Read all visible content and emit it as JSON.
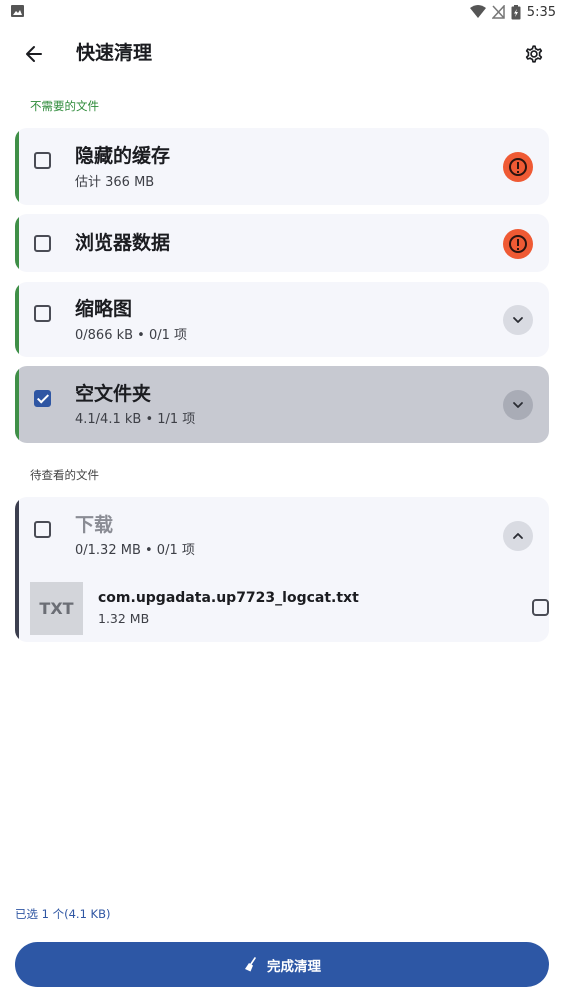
{
  "status_bar": {
    "time": "5:35"
  },
  "header": {
    "title": "快速清理"
  },
  "sections": {
    "unneeded": "不需要的文件",
    "review": "待查看的文件"
  },
  "cards": [
    {
      "title": "隐藏的缓存",
      "subtitle": "估计 366 MB",
      "checked": false,
      "icon": "warning-icon"
    },
    {
      "title": "浏览器数据",
      "subtitle": "",
      "checked": false,
      "icon": "warning-icon"
    },
    {
      "title": "缩略图",
      "subtitle": "0/866 kB • 0/1 项",
      "checked": false,
      "icon": "chevron-down-icon"
    },
    {
      "title": "空文件夹",
      "subtitle": "4.1/4.1 kB • 1/1 项",
      "checked": true,
      "icon": "chevron-down-icon"
    }
  ],
  "downloads": {
    "title": "下载",
    "subtitle": "0/1.32 MB • 0/1 项",
    "icon": "chevron-up-icon",
    "files": [
      {
        "thumb_label": "TXT",
        "name": "com.upgadata.up7723_logcat.txt",
        "size": "1.32 MB",
        "checked": false
      }
    ]
  },
  "footer": {
    "selection_summary": "已选 1 个(4.1 KB)",
    "finish_label": "完成清理"
  },
  "colors": {
    "accent_green": "#3f8f47",
    "primary_blue": "#2d57a5",
    "warning_orange": "#ef5a34"
  }
}
